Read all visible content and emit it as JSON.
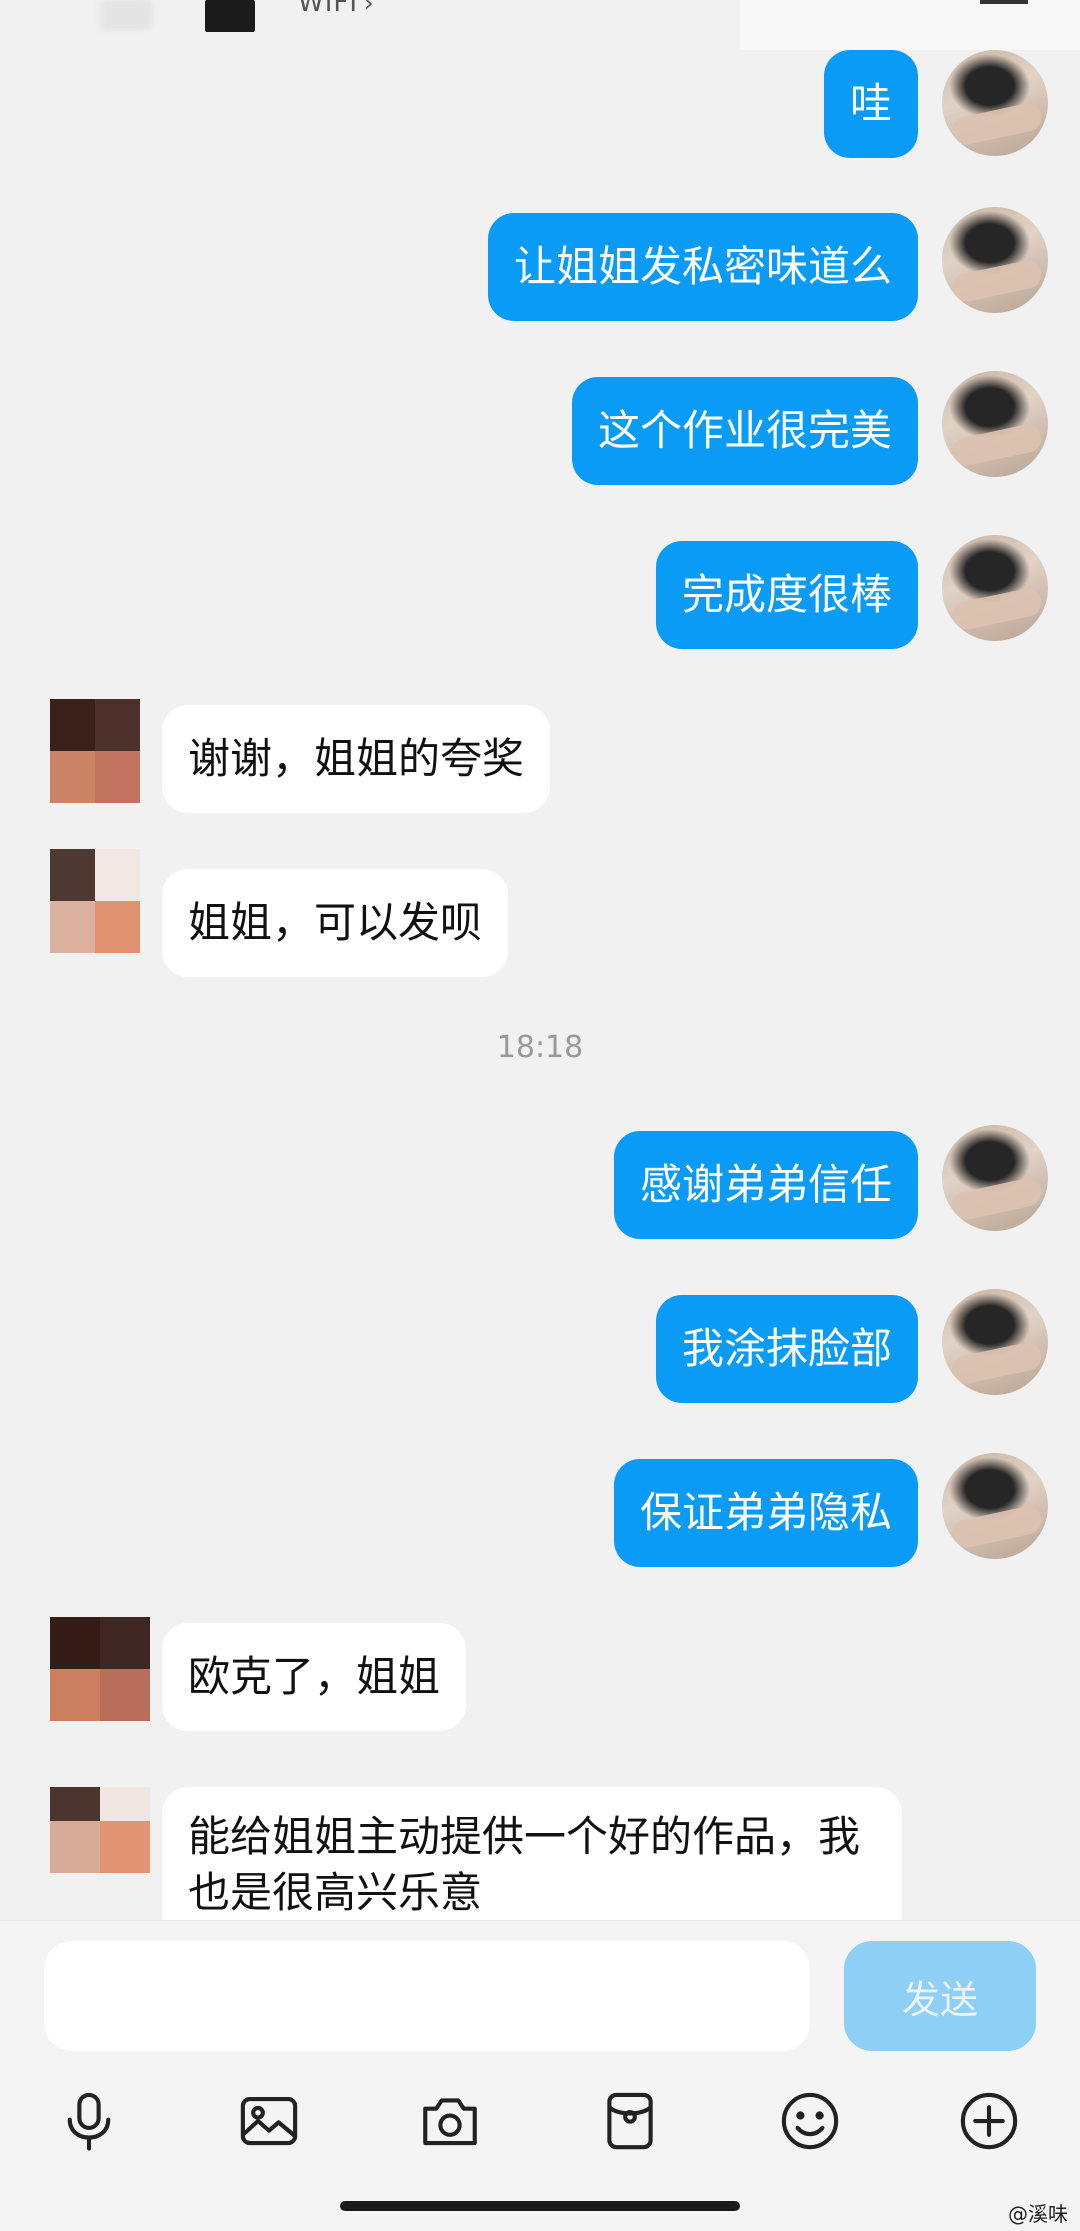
{
  "header": {
    "subtitle": "WIFI",
    "chevron": "›"
  },
  "messages": [
    {
      "side": "me",
      "text": "哇"
    },
    {
      "side": "me",
      "text": "让姐姐发私密味道么"
    },
    {
      "side": "me",
      "text": "这个作业很完美"
    },
    {
      "side": "me",
      "text": "完成度很棒"
    },
    {
      "side": "peer",
      "text": "谢谢，姐姐的夸奖"
    },
    {
      "side": "peer",
      "text": "姐姐，可以发呗"
    },
    {
      "side": "me",
      "text": "感谢弟弟信任"
    },
    {
      "side": "me",
      "text": "我涂抹脸部"
    },
    {
      "side": "me",
      "text": "保证弟弟隐私"
    },
    {
      "side": "peer",
      "text": "欧克了，姐姐"
    },
    {
      "side": "peer",
      "text": "能给姐姐主动提供一个好的作品，我也是很高兴乐意"
    }
  ],
  "time_separator": "18:18",
  "input": {
    "placeholder": "",
    "send_label": "发送"
  },
  "toolbar": [
    {
      "icon": "microphone-icon"
    },
    {
      "icon": "image-icon"
    },
    {
      "icon": "camera-icon"
    },
    {
      "icon": "red-packet-icon"
    },
    {
      "icon": "emoji-icon"
    },
    {
      "icon": "plus-icon"
    }
  ],
  "watermark": "@溪味",
  "colors": {
    "my_bubble": "#0a9bf6",
    "peer_bubble": "#ffffff",
    "background": "#f1f1f1",
    "send_button_disabled": "#8ecff6"
  }
}
